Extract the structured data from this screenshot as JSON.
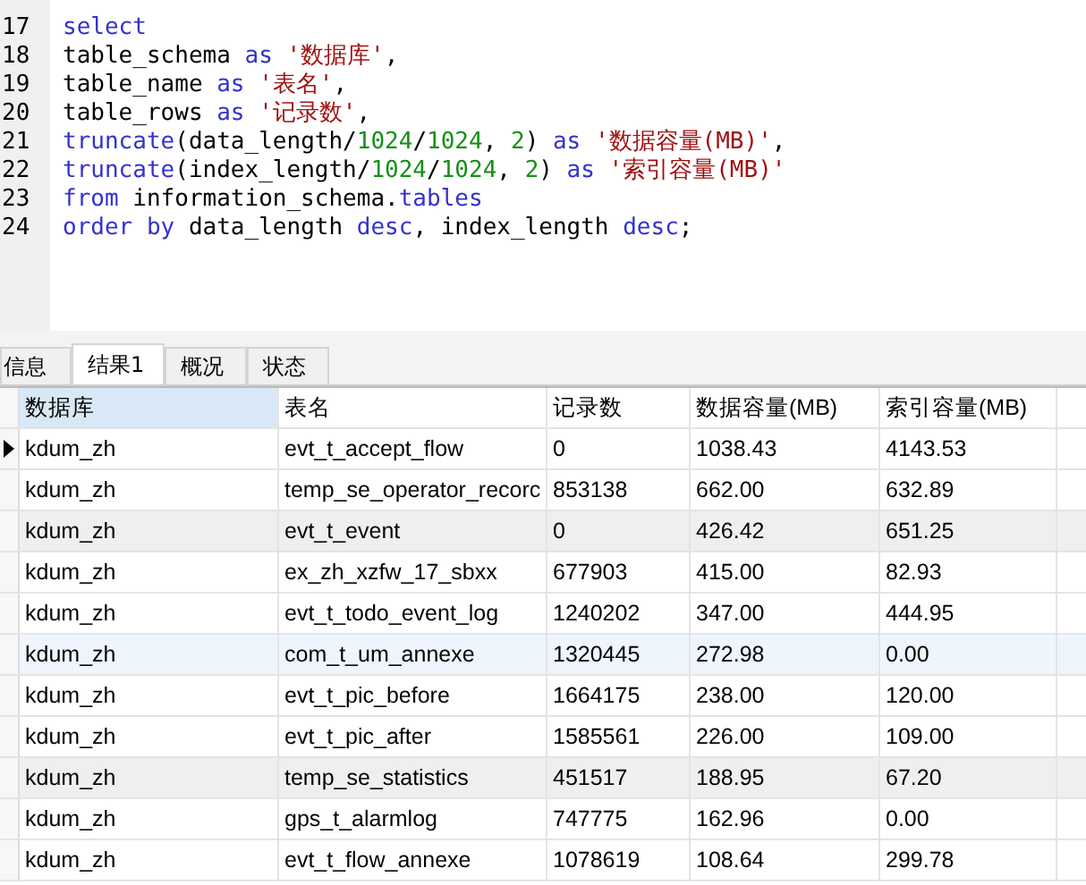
{
  "editor": {
    "lines": [
      {
        "number": "17",
        "tokens": [
          {
            "kind": "keyword",
            "text": "select"
          }
        ]
      },
      {
        "number": "18",
        "tokens": [
          {
            "kind": "ident",
            "text": "table_schema "
          },
          {
            "kind": "keyword",
            "text": "as"
          },
          {
            "kind": "string",
            "text": " '数据库'"
          },
          {
            "kind": "ident",
            "text": ","
          }
        ]
      },
      {
        "number": "19",
        "tokens": [
          {
            "kind": "ident",
            "text": "table_name "
          },
          {
            "kind": "keyword",
            "text": "as"
          },
          {
            "kind": "string",
            "text": " '表名'"
          },
          {
            "kind": "ident",
            "text": ","
          }
        ]
      },
      {
        "number": "20",
        "tokens": [
          {
            "kind": "ident",
            "text": "table_rows "
          },
          {
            "kind": "keyword",
            "text": "as"
          },
          {
            "kind": "string",
            "text": " '记录数'"
          },
          {
            "kind": "ident",
            "text": ","
          }
        ]
      },
      {
        "number": "21",
        "tokens": [
          {
            "kind": "keyword",
            "text": "truncate"
          },
          {
            "kind": "ident",
            "text": "(data_length/"
          },
          {
            "kind": "number",
            "text": "1024"
          },
          {
            "kind": "ident",
            "text": "/"
          },
          {
            "kind": "number",
            "text": "1024"
          },
          {
            "kind": "ident",
            "text": ", "
          },
          {
            "kind": "number",
            "text": "2"
          },
          {
            "kind": "ident",
            "text": ") "
          },
          {
            "kind": "keyword",
            "text": "as"
          },
          {
            "kind": "string",
            "text": " '数据容量(MB)'"
          },
          {
            "kind": "ident",
            "text": ","
          }
        ]
      },
      {
        "number": "22",
        "tokens": [
          {
            "kind": "keyword",
            "text": "truncate"
          },
          {
            "kind": "ident",
            "text": "(index_length/"
          },
          {
            "kind": "number",
            "text": "1024"
          },
          {
            "kind": "ident",
            "text": "/"
          },
          {
            "kind": "number",
            "text": "1024"
          },
          {
            "kind": "ident",
            "text": ", "
          },
          {
            "kind": "number",
            "text": "2"
          },
          {
            "kind": "ident",
            "text": ") "
          },
          {
            "kind": "keyword",
            "text": "as"
          },
          {
            "kind": "string",
            "text": " '索引容量(MB)'"
          }
        ]
      },
      {
        "number": "23",
        "tokens": [
          {
            "kind": "keyword",
            "text": "from"
          },
          {
            "kind": "ident",
            "text": " information_schema."
          },
          {
            "kind": "keyword",
            "text": "tables"
          }
        ]
      },
      {
        "number": "24",
        "tokens": [
          {
            "kind": "keyword",
            "text": "order by"
          },
          {
            "kind": "ident",
            "text": " data_length "
          },
          {
            "kind": "keyword",
            "text": "desc"
          },
          {
            "kind": "ident",
            "text": ", index_length "
          },
          {
            "kind": "keyword",
            "text": "desc"
          },
          {
            "kind": "ident",
            "text": ";"
          }
        ]
      }
    ]
  },
  "tabs": [
    {
      "label": "信息",
      "selected": false
    },
    {
      "label": "结果1",
      "selected": true
    },
    {
      "label": "概况",
      "selected": false
    },
    {
      "label": "状态",
      "selected": false
    }
  ],
  "table": {
    "columns": [
      {
        "label": "数据库",
        "selected": true
      },
      {
        "label": "表名",
        "selected": false
      },
      {
        "label": "记录数",
        "selected": false
      },
      {
        "label": "数据容量(MB)",
        "selected": false
      },
      {
        "label": "索引容量(MB)",
        "selected": false
      }
    ],
    "rows": [
      {
        "current": true,
        "kind": "plain",
        "cells": [
          "kdum_zh",
          "evt_t_accept_flow",
          "0",
          "1038.43",
          "4143.53"
        ]
      },
      {
        "current": false,
        "kind": "plain",
        "cells": [
          "kdum_zh",
          "temp_se_operator_recorc",
          "853138",
          "662.00",
          "632.89"
        ]
      },
      {
        "current": false,
        "kind": "grey",
        "cells": [
          "kdum_zh",
          "evt_t_event",
          "0",
          "426.42",
          "651.25"
        ]
      },
      {
        "current": false,
        "kind": "plain",
        "cells": [
          "kdum_zh",
          "ex_zh_xzfw_17_sbxx",
          "677903",
          "415.00",
          "82.93"
        ]
      },
      {
        "current": false,
        "kind": "plain",
        "cells": [
          "kdum_zh",
          "evt_t_todo_event_log",
          "1240202",
          "347.00",
          "444.95"
        ]
      },
      {
        "current": false,
        "kind": "blue",
        "cells": [
          "kdum_zh",
          "com_t_um_annexe",
          "1320445",
          "272.98",
          "0.00"
        ]
      },
      {
        "current": false,
        "kind": "plain",
        "cells": [
          "kdum_zh",
          "evt_t_pic_before",
          "1664175",
          "238.00",
          "120.00"
        ]
      },
      {
        "current": false,
        "kind": "plain",
        "cells": [
          "kdum_zh",
          "evt_t_pic_after",
          "1585561",
          "226.00",
          "109.00"
        ]
      },
      {
        "current": false,
        "kind": "grey",
        "cells": [
          "kdum_zh",
          "temp_se_statistics",
          "451517",
          "188.95",
          "67.20"
        ]
      },
      {
        "current": false,
        "kind": "plain",
        "cells": [
          "kdum_zh",
          "gps_t_alarmlog",
          "747775",
          "162.96",
          "0.00"
        ]
      },
      {
        "current": false,
        "kind": "plain",
        "cells": [
          "kdum_zh",
          "evt_t_flow_annexe",
          "1078619",
          "108.64",
          "299.78"
        ]
      }
    ]
  }
}
